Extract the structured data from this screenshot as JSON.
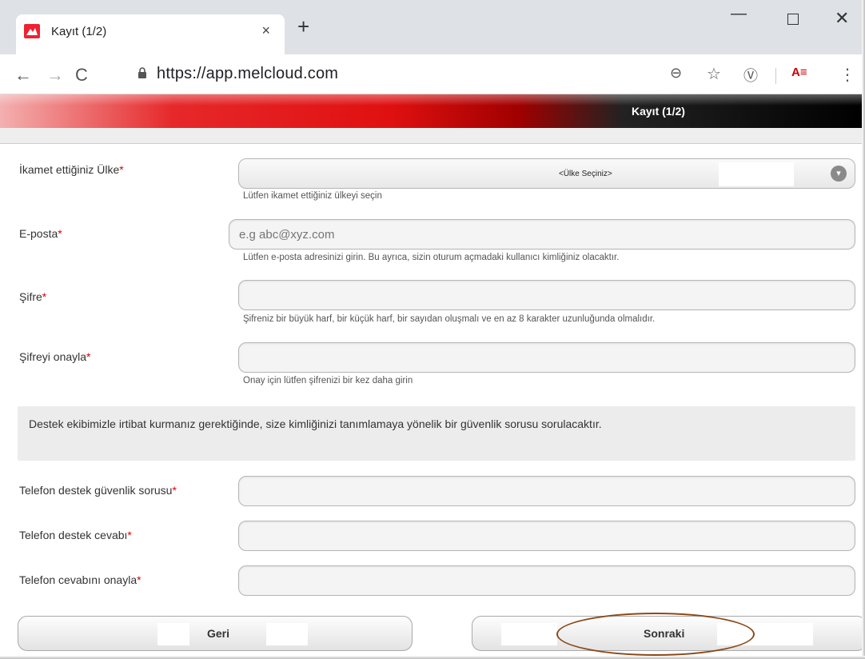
{
  "browser": {
    "tab_title": "Kayıt (1/2)",
    "tab_close": "×",
    "new_tab": "+",
    "url": "https://app.melcloud.com",
    "window_buttons": {
      "minimize": "—",
      "close": "✕"
    },
    "icons": {
      "back": "←",
      "forward": "→",
      "reload": "C",
      "zoom": "⊖",
      "star": "☆",
      "ext_v": "Ⓥ",
      "menu": "⋮",
      "ext_logo": "A≡"
    }
  },
  "header": {
    "title": "Kayıt (1/2)"
  },
  "colors": {
    "header_red": "#e01010",
    "header_black": "#000000",
    "required": "#dd0000",
    "circle": "#8a4a1a"
  },
  "form": {
    "country": {
      "label": "İkamet ettiğiniz Ülke",
      "required": "*",
      "value": "<Ülke Seçiniz>",
      "hint": "Lütfen ikamet ettiğiniz ülkeyi seçin"
    },
    "email": {
      "label": "E-posta",
      "required": "*",
      "placeholder": "e.g abc@xyz.com",
      "hint": "Lütfen e-posta adresinizi girin. Bu ayrıca, sizin oturum açmadaki kullanıcı kimliğiniz olacaktır."
    },
    "password": {
      "label": "Şifre",
      "required": "*",
      "hint": "Şifreniz bir büyük harf, bir küçük harf, bir sayıdan oluşmalı ve en az 8 karakter uzunluğunda olmalıdır."
    },
    "password_confirm": {
      "label": "Şifreyi onayla",
      "required": "*",
      "hint": "Onay için lütfen şifrenizi bir kez daha girin"
    },
    "info_text": "Destek ekibimizle irtibat kurmanız gerektiğinde, size kimliğinizi tanımlamaya yönelik bir güvenlik sorusu sorulacaktır.",
    "security_question": {
      "label": "Telefon destek güvenlik sorusu",
      "required": "*"
    },
    "security_answer": {
      "label": "Telefon destek cevabı",
      "required": "*"
    },
    "security_answer_confirm": {
      "label": "Telefon cevabını onayla",
      "required": "*"
    }
  },
  "buttons": {
    "back": "Geri",
    "next": "Sonraki"
  }
}
